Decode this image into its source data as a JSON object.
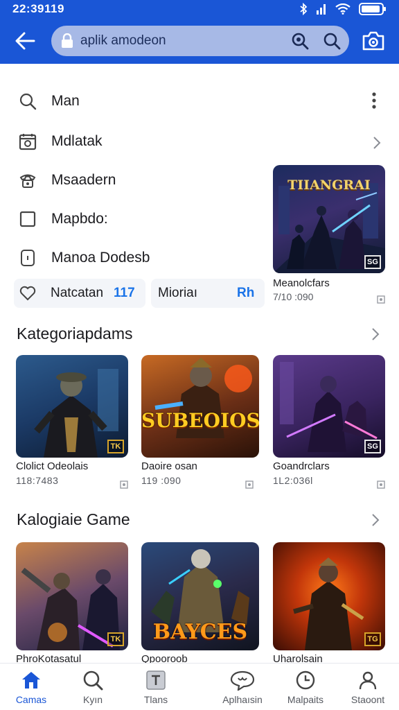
{
  "status_bar": {
    "time": "22:39119"
  },
  "search": {
    "value": "aplik amodeon"
  },
  "menu": {
    "items": [
      {
        "label": "Man",
        "icon": "search-icon"
      },
      {
        "label": "Mdlatak",
        "icon": "calendar-icon"
      },
      {
        "label": "Msaadern",
        "icon": "phone-icon"
      },
      {
        "label": "Mapbdo:",
        "icon": "square-icon"
      },
      {
        "label": "Manoa Dodesb",
        "icon": "device-icon"
      }
    ],
    "pill_left": {
      "label": "Natcatan",
      "count": "117",
      "icon": "heart-icon"
    },
    "pill_right": {
      "label": "Mioriaı",
      "count": "Rh"
    }
  },
  "featured": {
    "title": "Meanolcfars",
    "sub": "7/10 :090",
    "logo": "TIIANGRAI",
    "badge": "SG"
  },
  "sections": [
    {
      "title": "Kategoriapdams",
      "games": [
        {
          "name": "Clolict Odeolais",
          "sub": "118:7483",
          "badge": "TK"
        },
        {
          "name": "Daoire osan",
          "sub": "119 :090",
          "logo": "SUBEOIOS"
        },
        {
          "name": "Goandrclars",
          "sub": "1L2:036l",
          "badge": "SG"
        }
      ]
    },
    {
      "title": "Kalogiaie Game",
      "games": [
        {
          "name": "PhroKotasatul",
          "badge": "TK"
        },
        {
          "name": "Qpooroob",
          "logo": "BAYCES"
        },
        {
          "name": "Uharolsain",
          "badge": "TG"
        }
      ]
    }
  ],
  "bottom_nav": [
    {
      "label": "Camas",
      "icon": "home-icon",
      "active": true
    },
    {
      "label": "Kyın",
      "icon": "search-icon"
    },
    {
      "label": "Tlans",
      "icon": "t-box-icon"
    },
    {
      "label": "Aplhaısin",
      "icon": "chat-icon"
    },
    {
      "label": "Malpaits",
      "icon": "clock-icon"
    },
    {
      "label": "Staoont",
      "icon": "person-icon"
    }
  ],
  "colors": {
    "primary": "#1a56d6",
    "accent_text": "#1a73e8",
    "search_bg": "#a7b9e6"
  }
}
